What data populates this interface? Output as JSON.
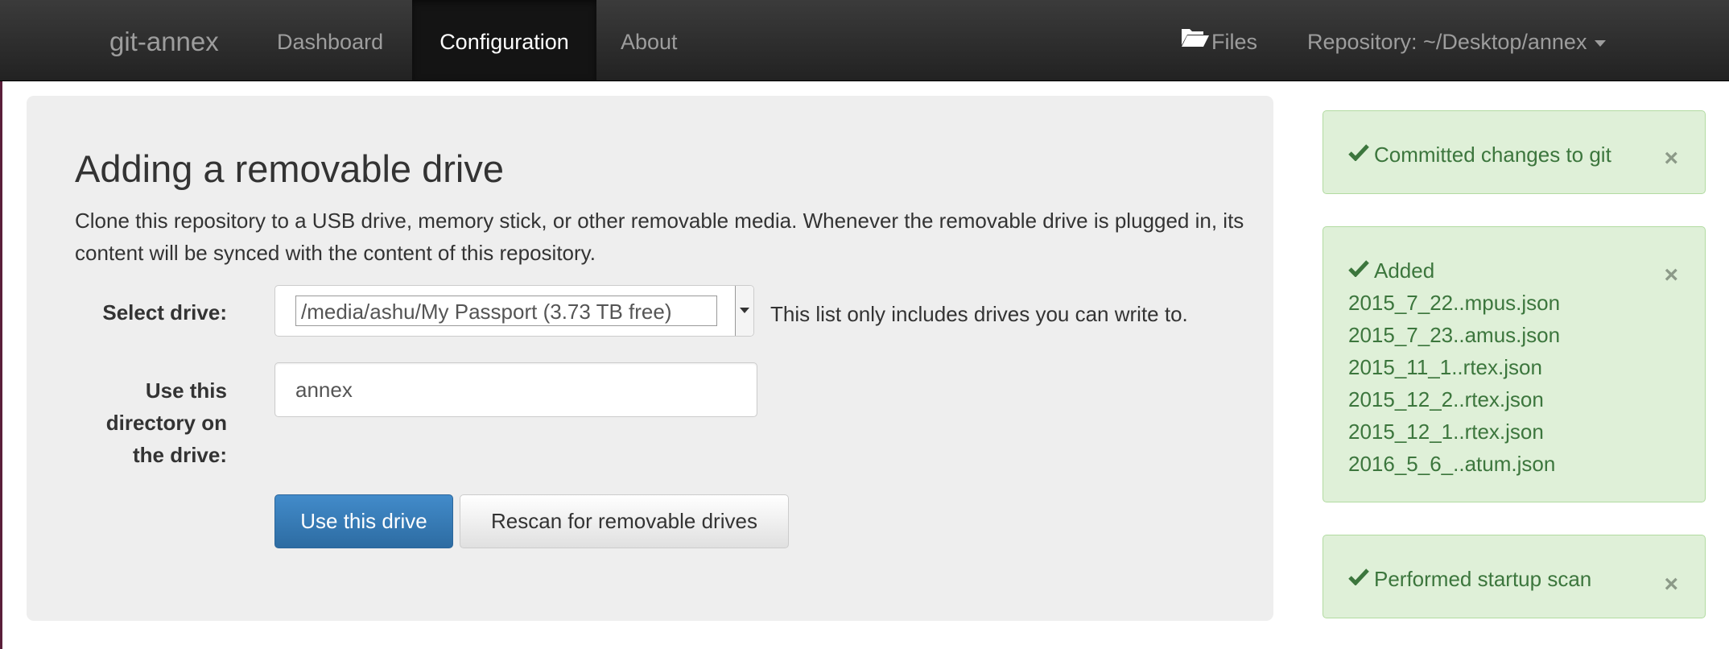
{
  "navbar": {
    "brand": "git-annex",
    "items": [
      {
        "label": "Dashboard"
      },
      {
        "label": "Configuration"
      },
      {
        "label": "About"
      }
    ],
    "files_label": "Files",
    "repository_label": "Repository: ~/Desktop/annex"
  },
  "main": {
    "title": "Adding a removable drive",
    "description": "Clone this repository to a USB drive, memory stick, or other removable media. Whenever the removable drive is plugged in, its content will be synced with the content of this repository.",
    "select_drive_label": "Select drive:",
    "selected_drive": "/media/ashu/My Passport (3.73 TB free)",
    "drive_help": "This list only includes drives you can write to.",
    "directory_label_lines": [
      "Use this",
      "directory on",
      "the drive:"
    ],
    "directory_value": "annex",
    "use_button": "Use this drive",
    "rescan_button": "Rescan for removable drives"
  },
  "alerts": [
    {
      "lines": [
        "Committed changes to git"
      ]
    },
    {
      "lines": [
        "Added",
        "2015_7_22..mpus.json",
        "2015_7_23..amus.json",
        "2015_11_1..rtex.json",
        "2015_12_2..rtex.json",
        "2015_12_1..rtex.json",
        "2016_5_6_..atum.json"
      ]
    },
    {
      "lines": [
        "Performed startup scan"
      ]
    }
  ],
  "colors": {
    "navbar": "#222222",
    "primary": "#428bca",
    "alert_success_bg": "#dff0d8",
    "alert_success_text": "#3c763d"
  },
  "icons": {
    "files": "folder-open-icon",
    "repository": "caret-down-icon",
    "alerts": "check-icon",
    "dismiss": "close-icon"
  }
}
